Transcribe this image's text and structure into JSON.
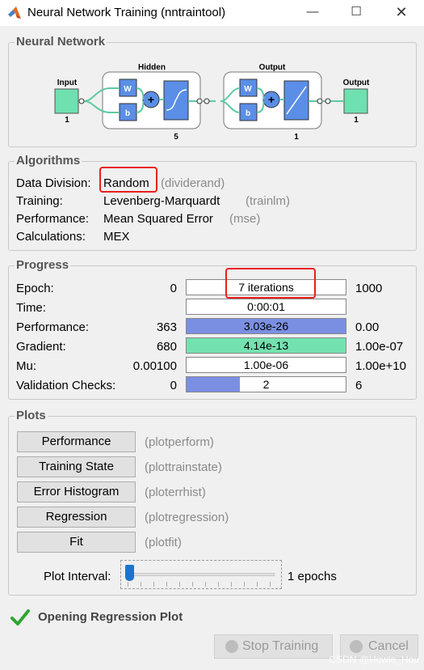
{
  "window": {
    "title": "Neural Network Training (nntraintool)"
  },
  "network": {
    "legend": "Neural Network",
    "input_label": "Input",
    "input_count": "1",
    "hidden_label": "Hidden",
    "hidden_count": "5",
    "output_layer_label": "Output",
    "output_layer_count": "1",
    "output_label": "Output",
    "output_count": "1",
    "w_label": "W",
    "b_label": "b"
  },
  "algorithms": {
    "legend": "Algorithms",
    "rows": [
      {
        "label": "Data Division:",
        "value": "Random",
        "fn": "(dividerand)"
      },
      {
        "label": "Training:",
        "value": "Levenberg-Marquardt",
        "fn": "(trainlm)"
      },
      {
        "label": "Performance:",
        "value": "Mean Squared Error",
        "fn": "(mse)"
      },
      {
        "label": "Calculations:",
        "value": "MEX",
        "fn": ""
      }
    ]
  },
  "progress": {
    "legend": "Progress",
    "rows": [
      {
        "label": "Epoch:",
        "start": "0",
        "current": "7 iterations",
        "end": "1000",
        "fill": 0,
        "color": "#ffffff"
      },
      {
        "label": "Time:",
        "start": "",
        "current": "0:00:01",
        "end": "",
        "fill": 0,
        "color": "#ffffff"
      },
      {
        "label": "Performance:",
        "start": "363",
        "current": "3.03e-26",
        "end": "0.00",
        "fill": 1.0,
        "color": "#7b8fe2"
      },
      {
        "label": "Gradient:",
        "start": "680",
        "current": "4.14e-13",
        "end": "1.00e-07",
        "fill": 1.0,
        "color": "#74e2b0"
      },
      {
        "label": "Mu:",
        "start": "0.00100",
        "current": "1.00e-06",
        "end": "1.00e+10",
        "fill": 0,
        "color": "#ffffff"
      },
      {
        "label": "Validation Checks:",
        "start": "0",
        "current": "2",
        "end": "6",
        "fill": 0.333,
        "color": "#7b8fe2"
      }
    ]
  },
  "plots": {
    "legend": "Plots",
    "buttons": [
      {
        "label": "Performance",
        "fn": "(plotperform)"
      },
      {
        "label": "Training State",
        "fn": "(plottrainstate)"
      },
      {
        "label": "Error Histogram",
        "fn": "(ploterrhist)"
      },
      {
        "label": "Regression",
        "fn": "(plotregression)"
      },
      {
        "label": "Fit",
        "fn": "(plotfit)"
      }
    ],
    "interval_label": "Plot Interval:",
    "interval_value": "1 epochs",
    "interval_slider_level": 0
  },
  "status": {
    "text": "Opening Regression Plot"
  },
  "footer": {
    "stop_label": "Stop Training",
    "cancel_label": "Cancel"
  },
  "watermark": "CSDN @Howie_Hou",
  "colors": {
    "progress_blue": "#7b8fe2",
    "progress_green": "#74e2b0",
    "highlight_red": "#e8201c",
    "layer_blue": "#5b8ee6",
    "io_green": "#6fe0b0"
  }
}
